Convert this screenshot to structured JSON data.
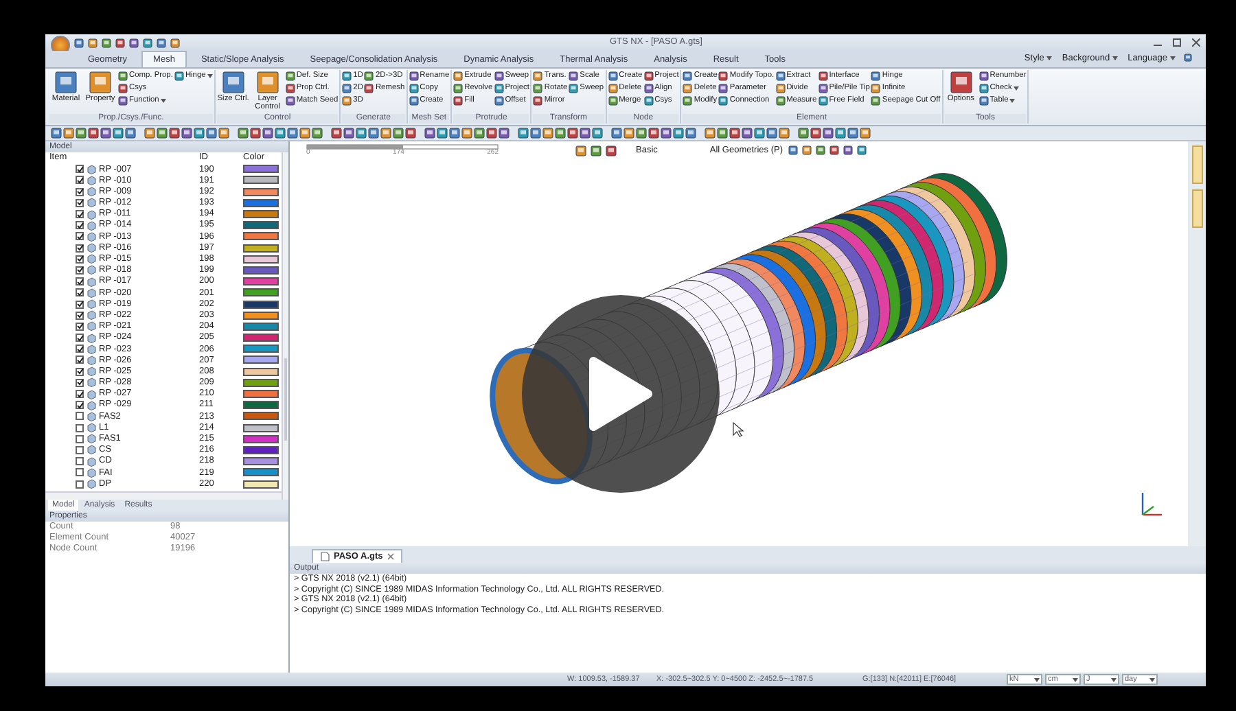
{
  "window": {
    "title": "GTS NX - [PASO A.gts]"
  },
  "ribbon_tabs": [
    {
      "label": "Geometry",
      "selected": false
    },
    {
      "label": "Mesh",
      "selected": true
    },
    {
      "label": "Static/Slope Analysis",
      "selected": false
    },
    {
      "label": "Seepage/Consolidation Analysis",
      "selected": false
    },
    {
      "label": "Dynamic Analysis",
      "selected": false
    },
    {
      "label": "Thermal Analysis",
      "selected": false
    },
    {
      "label": "Analysis",
      "selected": false
    },
    {
      "label": "Result",
      "selected": false
    },
    {
      "label": "Tools",
      "selected": false
    }
  ],
  "ribbon_right": [
    {
      "label": "Style",
      "dropdown": true
    },
    {
      "label": "Background",
      "dropdown": true
    },
    {
      "label": "Language",
      "dropdown": true
    }
  ],
  "ribbon_groups": [
    {
      "label": "Prop./Csys./Func.",
      "columns": [
        [
          {
            "label": "Material",
            "kind": "large"
          }
        ],
        [
          {
            "label": "Property",
            "kind": "large"
          }
        ],
        [
          {
            "label": "Comp. Prop.",
            "kind": "small"
          },
          {
            "label": "Csys",
            "kind": "small"
          },
          {
            "label": "Function",
            "kind": "small",
            "dropdown": true
          }
        ],
        [
          {
            "label": "Hinge",
            "kind": "small",
            "dropdown": true
          }
        ]
      ]
    },
    {
      "label": "Control",
      "columns": [
        [
          {
            "label": "Size Ctrl.",
            "kind": "large"
          }
        ],
        [
          {
            "label": "Layer Control",
            "kind": "large"
          }
        ],
        [
          {
            "label": "Def. Size",
            "kind": "small"
          },
          {
            "label": "Prop Ctrl.",
            "kind": "small"
          },
          {
            "label": "Match Seed",
            "kind": "small"
          }
        ]
      ]
    },
    {
      "label": "Generate",
      "columns": [
        [
          {
            "label": "1D",
            "kind": "small"
          },
          {
            "label": "2D",
            "kind": "small"
          },
          {
            "label": "3D",
            "kind": "small"
          }
        ],
        [
          {
            "label": "2D->3D",
            "kind": "small"
          },
          {
            "label": "Remesh",
            "kind": "small"
          }
        ]
      ]
    },
    {
      "label": "Mesh Set",
      "columns": [
        [
          {
            "label": "Rename",
            "kind": "small"
          },
          {
            "label": "Copy",
            "kind": "small"
          },
          {
            "label": "Create",
            "kind": "small"
          }
        ]
      ]
    },
    {
      "label": "Protrude",
      "columns": [
        [
          {
            "label": "Extrude",
            "kind": "small"
          },
          {
            "label": "Revolve",
            "kind": "small"
          },
          {
            "label": "Fill",
            "kind": "small"
          }
        ],
        [
          {
            "label": "Sweep",
            "kind": "small"
          },
          {
            "label": "Project",
            "kind": "small"
          },
          {
            "label": "Offset",
            "kind": "small"
          }
        ]
      ]
    },
    {
      "label": "Transform",
      "columns": [
        [
          {
            "label": "Trans.",
            "kind": "small"
          },
          {
            "label": "Rotate",
            "kind": "small"
          },
          {
            "label": "Mirror",
            "kind": "small"
          }
        ],
        [
          {
            "label": "Scale",
            "kind": "small"
          },
          {
            "label": "Sweep",
            "kind": "small"
          }
        ]
      ]
    },
    {
      "label": "Node",
      "columns": [
        [
          {
            "label": "Create",
            "kind": "small"
          },
          {
            "label": "Delete",
            "kind": "small"
          },
          {
            "label": "Merge",
            "kind": "small"
          }
        ],
        [
          {
            "label": "Project",
            "kind": "small"
          },
          {
            "label": "Align",
            "kind": "small"
          },
          {
            "label": "Csys",
            "kind": "small"
          }
        ]
      ]
    },
    {
      "label": "Element",
      "columns": [
        [
          {
            "label": "Create",
            "kind": "small"
          },
          {
            "label": "Delete",
            "kind": "small"
          },
          {
            "label": "Modify",
            "kind": "small"
          }
        ],
        [
          {
            "label": "Modify Topo.",
            "kind": "small"
          },
          {
            "label": "Parameter",
            "kind": "small"
          },
          {
            "label": "Connection",
            "kind": "small"
          }
        ],
        [
          {
            "label": "Extract",
            "kind": "small"
          },
          {
            "label": "Divide",
            "kind": "small"
          },
          {
            "label": "Measure",
            "kind": "small"
          }
        ],
        [
          {
            "label": "Interface",
            "kind": "small"
          },
          {
            "label": "Pile/Pile Tip",
            "kind": "small"
          },
          {
            "label": "Free Field",
            "kind": "small"
          }
        ],
        [
          {
            "label": "Hinge",
            "kind": "small"
          },
          {
            "label": "Infinite",
            "kind": "small"
          },
          {
            "label": "Seepage Cut Off",
            "kind": "small"
          }
        ]
      ]
    },
    {
      "label": "Tools",
      "columns": [
        [
          {
            "label": "Options",
            "kind": "large"
          }
        ],
        [
          {
            "label": "Renumber",
            "kind": "small"
          },
          {
            "label": "Check",
            "kind": "small",
            "dropdown": true
          },
          {
            "label": "Table",
            "kind": "small",
            "dropdown": true
          }
        ]
      ]
    }
  ],
  "model_panel": {
    "title": "Model",
    "columns": [
      "Item",
      "ID",
      "Color"
    ],
    "rows": [
      {
        "name": "RP -007",
        "id": "190",
        "checked": true,
        "color": "#8a70d8"
      },
      {
        "name": "RP -010",
        "id": "191",
        "checked": true,
        "color": "#b8b8c0"
      },
      {
        "name": "RP -009",
        "id": "192",
        "checked": true,
        "color": "#f08860"
      },
      {
        "name": "RP -012",
        "id": "193",
        "checked": true,
        "color": "#1a70e0"
      },
      {
        "name": "RP -011",
        "id": "194",
        "checked": true,
        "color": "#c87810"
      },
      {
        "name": "RP -014",
        "id": "195",
        "checked": true,
        "color": "#106878"
      },
      {
        "name": "RP -013",
        "id": "196",
        "checked": true,
        "color": "#f07840"
      },
      {
        "name": "RP -016",
        "id": "197",
        "checked": true,
        "color": "#c0b020"
      },
      {
        "name": "RP -015",
        "id": "198",
        "checked": true,
        "color": "#e8c8d8"
      },
      {
        "name": "RP -018",
        "id": "199",
        "checked": true,
        "color": "#6858c0"
      },
      {
        "name": "RP -017",
        "id": "200",
        "checked": true,
        "color": "#e040a0"
      },
      {
        "name": "RP -020",
        "id": "201",
        "checked": true,
        "color": "#40a020"
      },
      {
        "name": "RP -019",
        "id": "202",
        "checked": true,
        "color": "#183868"
      },
      {
        "name": "RP -022",
        "id": "203",
        "checked": true,
        "color": "#f09020"
      },
      {
        "name": "RP -021",
        "id": "204",
        "checked": true,
        "color": "#1888a8"
      },
      {
        "name": "RP -024",
        "id": "205",
        "checked": true,
        "color": "#d02870"
      },
      {
        "name": "RP -023",
        "id": "206",
        "checked": true,
        "color": "#1898c0"
      },
      {
        "name": "RP -026",
        "id": "207",
        "checked": true,
        "color": "#a8a8f0"
      },
      {
        "name": "RP -025",
        "id": "208",
        "checked": true,
        "color": "#f0c8a0"
      },
      {
        "name": "RP -028",
        "id": "209",
        "checked": true,
        "color": "#70a010"
      },
      {
        "name": "RP -027",
        "id": "210",
        "checked": true,
        "color": "#f07040"
      },
      {
        "name": "RP -029",
        "id": "211",
        "checked": true,
        "color": "#106840"
      },
      {
        "name": "FAS2",
        "id": "213",
        "checked": false,
        "color": "#c85810"
      },
      {
        "name": "L1",
        "id": "214",
        "checked": false,
        "color": "#c0c0c8"
      },
      {
        "name": "FAS1",
        "id": "215",
        "checked": false,
        "color": "#d030c0"
      },
      {
        "name": "CS",
        "id": "216",
        "checked": false,
        "color": "#6020c0"
      },
      {
        "name": "CD",
        "id": "218",
        "checked": false,
        "color": "#a890e0"
      },
      {
        "name": "FAI",
        "id": "219",
        "checked": false,
        "color": "#1890c8"
      },
      {
        "name": "DP",
        "id": "220",
        "checked": false,
        "color": "#f0e8b0"
      }
    ]
  },
  "panel_tabs": [
    {
      "label": "Model",
      "selected": true
    },
    {
      "label": "Analysis",
      "selected": false
    },
    {
      "label": "Results",
      "selected": false
    }
  ],
  "properties": {
    "title": "Properties",
    "rows": [
      {
        "label": "Count",
        "value": "98"
      },
      {
        "label": "Element Count",
        "value": "40027"
      },
      {
        "label": "Node Count",
        "value": "19196"
      }
    ]
  },
  "viewport": {
    "scale_labels": [
      "0",
      "174",
      "262"
    ],
    "display_mode": "Basic",
    "filter": "All Geometries (P)"
  },
  "document_tab": {
    "label": "PASO A.gts"
  },
  "output": {
    "title": "Output",
    "lines": [
      "> GTS NX 2018 (v2.1) (64bit)",
      "> Copyright (C) SINCE 1989 MIDAS Information Technology Co., Ltd. ALL RIGHTS RESERVED.",
      "> GTS NX 2018 (v2.1) (64bit)",
      "> Copyright (C) SINCE 1989 MIDAS Information Technology Co., Ltd. ALL RIGHTS RESERVED."
    ]
  },
  "status_bar": {
    "cursor": "W: 1009.53, -1589.37",
    "range": "X: -302.5~302.5 Y: 0~4500 Z: -2452.5~-1787.5",
    "counts": "G:[133] N:[42011] E:[76046]",
    "units": [
      "kN",
      "cm",
      "J",
      "day"
    ]
  }
}
